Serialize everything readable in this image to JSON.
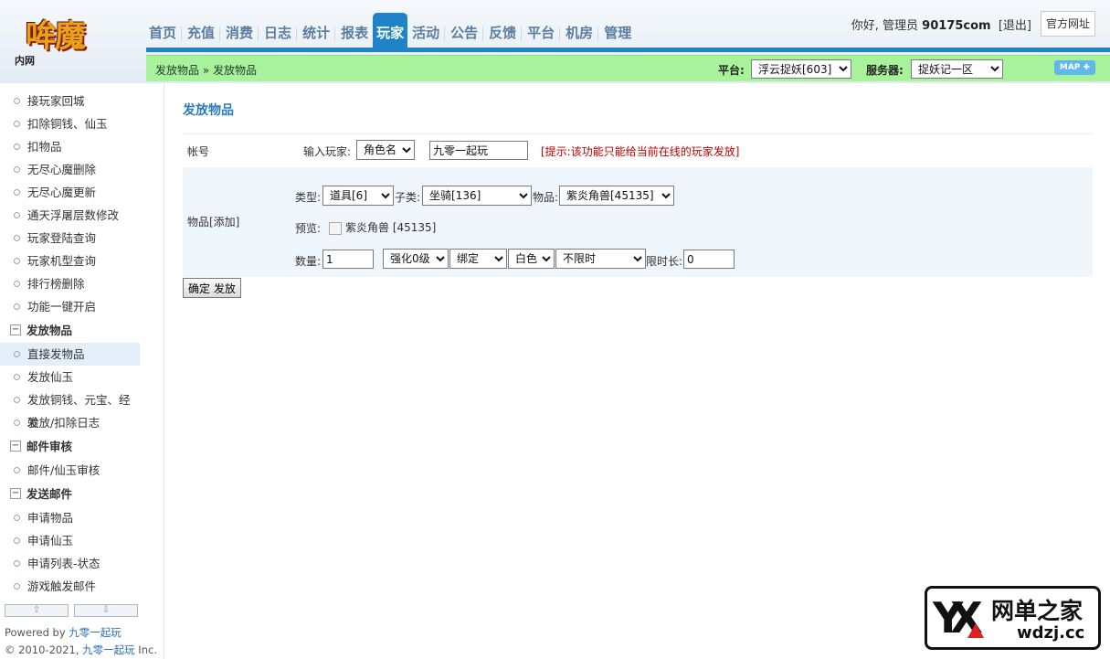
{
  "header": {
    "logo_text": "哞魔",
    "logo_sub": "内网",
    "nav": [
      "首页",
      "充值",
      "消费",
      "日志",
      "统计",
      "报表",
      "玩家",
      "活动",
      "公告",
      "反馈",
      "平台",
      "机房",
      "管理"
    ],
    "nav_active_index": 6,
    "greeting": "你好, 管理员",
    "username": "90175com",
    "logout": "[退出]",
    "site_button": "官方网址"
  },
  "subbar": {
    "breadcrumb": "发放物品 » 发放物品",
    "platform_label": "平台:",
    "platform_value": "浮云捉妖[603]",
    "server_label": "服务器:",
    "server_value": "捉妖记一区",
    "map_button": "MAP ✚"
  },
  "sidebar": {
    "items_top": [
      "接玩家回城",
      "扣除铜钱、仙玉",
      "扣物品",
      "无尽心魔删除",
      "无尽心魔更新",
      "通天浮屠层数修改",
      "玩家登陆查询",
      "玩家机型查询",
      "排行榜删除",
      "功能一键开启"
    ],
    "group1": "发放物品",
    "group1_items": [
      "直接发物品",
      "发放仙玉",
      "发放铜钱、元宝、经验",
      "发放/扣除日志"
    ],
    "group2": "邮件审核",
    "group2_items": [
      "邮件/仙玉审核"
    ],
    "group3": "发送邮件",
    "group3_items": [
      "申请物品",
      "申请仙玉",
      "申请列表-状态",
      "游戏触发邮件"
    ],
    "scroll_up": "⇧",
    "scroll_down": "⇩",
    "powered_prefix": "Powered by ",
    "brand": "九零一起玩",
    "copyright_prefix": "© 2010-2021, ",
    "copyright_suffix": " Inc."
  },
  "main": {
    "title": "发放物品",
    "account": {
      "label": "帐号",
      "input_label": "输入玩家:",
      "type_select": "角色名",
      "player_value": "九零一起玩",
      "hint": "[提示:该功能只能给当前在线的玩家发放]"
    },
    "items": {
      "label": "物品[添加]",
      "type_label": "类型:",
      "type_value": "道具[6]",
      "subtype_label": "子类:",
      "subtype_value": "坐骑[136]",
      "item_label": "物品:",
      "item_value": "紫炎角兽[45135]",
      "preview_label": "预览:",
      "preview_text": "紫炎角兽 [45135]",
      "qty_label": "数量:",
      "qty_value": "1",
      "enhance_value": "强化0级",
      "bind_value": "绑定",
      "color_value": "白色",
      "limit_value": "不限时",
      "limit_len_label": "限时长:",
      "limit_len_value": "0"
    },
    "submit": "确定 发放"
  },
  "watermark": {
    "cn": "网单之家",
    "en": "wdzj.cc"
  }
}
